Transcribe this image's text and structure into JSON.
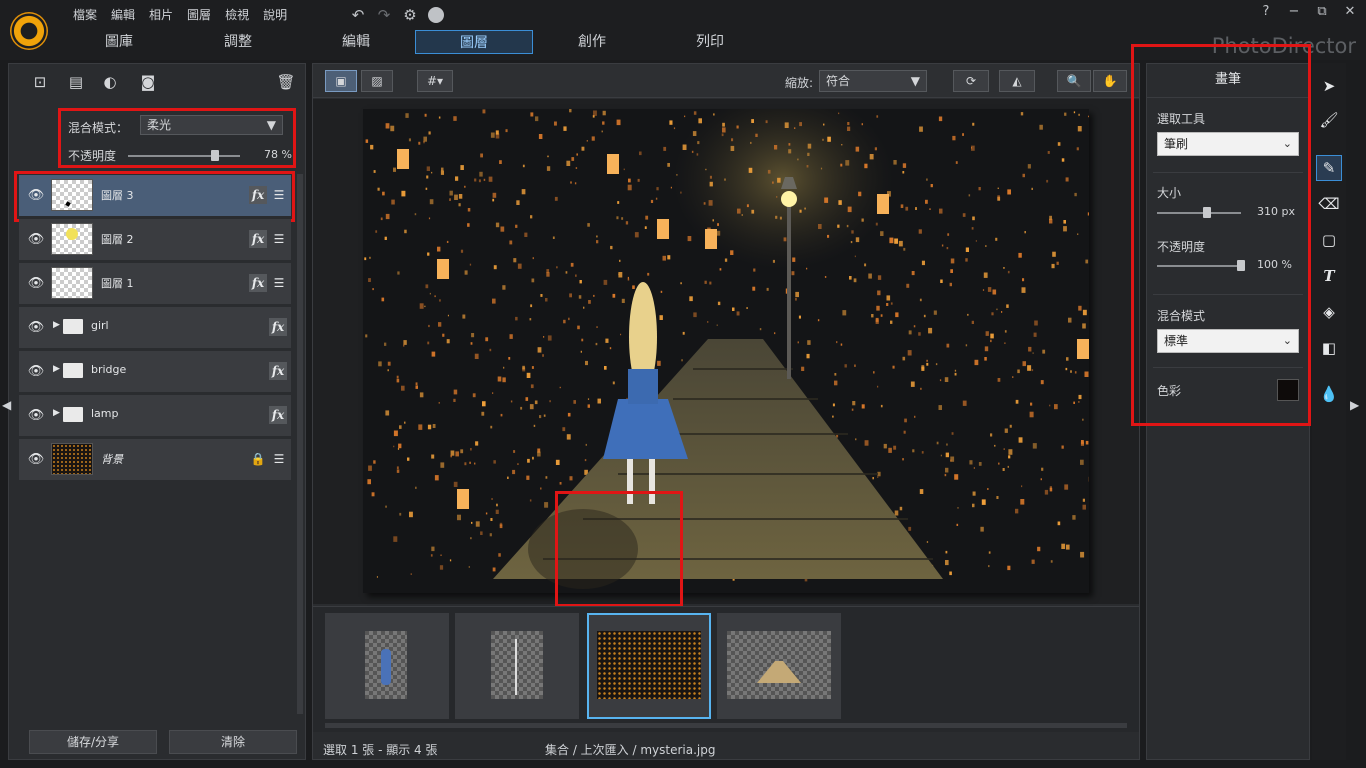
{
  "app": {
    "brand": "PhotoDirector",
    "menu": [
      "檔案",
      "編輯",
      "相片",
      "圖層",
      "檢視",
      "說明"
    ],
    "mode_tabs": [
      {
        "label": "圖庫",
        "active": false
      },
      {
        "label": "調整",
        "active": false
      },
      {
        "label": "編輯",
        "active": false
      },
      {
        "label": "圖層",
        "active": true
      },
      {
        "label": "創作",
        "active": false
      },
      {
        "label": "列印",
        "active": false
      }
    ],
    "window_controls": [
      "?",
      "−",
      "⧉",
      "✕"
    ]
  },
  "layers_panel": {
    "blend_mode_label": "混合模式：",
    "blend_mode_value": "柔光",
    "opacity_label": "不透明度",
    "opacity_value": "78 %",
    "opacity_fraction": 0.78,
    "layers": [
      {
        "name": "圖層 3",
        "type": "layer",
        "selected": true,
        "fx": "fx"
      },
      {
        "name": "圖層 2",
        "type": "layer",
        "selected": false,
        "fx": "fx"
      },
      {
        "name": "圖層 1",
        "type": "layer",
        "selected": false,
        "fx": "fx"
      },
      {
        "name": "girl",
        "type": "group",
        "selected": false,
        "fx": "fx"
      },
      {
        "name": "bridge",
        "type": "group",
        "selected": false,
        "fx": "fx"
      },
      {
        "name": "lamp",
        "type": "group",
        "selected": false,
        "fx": "fx"
      },
      {
        "name": "背景",
        "type": "background",
        "selected": false,
        "locked": true
      }
    ],
    "save_share_label": "儲存/分享",
    "clear_label": "清除"
  },
  "center": {
    "zoom_label": "縮放:",
    "zoom_value": "符合",
    "status_left": "選取 1 張 - 顯示 4 張",
    "status_right": "集合 / 上次匯入 / mysteria.jpg"
  },
  "brush_panel": {
    "title": "畫筆",
    "select_tool_label": "選取工具",
    "select_tool_value": "筆刷",
    "size_label": "大小",
    "size_value": "310 px",
    "size_fraction": 0.6,
    "opacity_label": "不透明度",
    "opacity_value": "100 %",
    "opacity_fraction": 1.0,
    "blend_label": "混合模式",
    "blend_value": "標準",
    "color_label": "色彩",
    "color_swatch": "#0e0b0a"
  },
  "colors": {
    "accent": "#3b8ed6",
    "highlight": "#e01515"
  }
}
